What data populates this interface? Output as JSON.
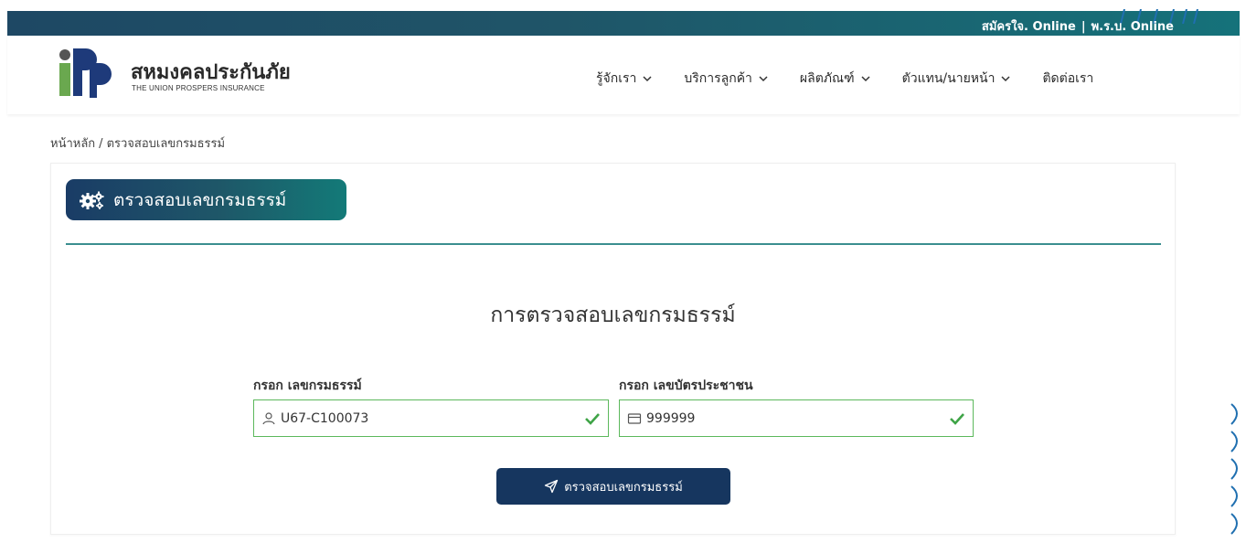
{
  "topbar": {
    "link_1": "สมัครใจ. Online",
    "separator": "|",
    "link_2": "พ.ร.บ. Online"
  },
  "brand": {
    "name_th": "สหมงคลประกันภัย",
    "name_en": "THE UNION PROSPERS INSURANCE",
    "colors": {
      "navy": "#16365f",
      "teal": "#137a78",
      "green": "#6aa84f"
    }
  },
  "nav": {
    "items": [
      {
        "label": "รู้จักเรา",
        "has_dropdown": true
      },
      {
        "label": "บริการลูกค้า",
        "has_dropdown": true
      },
      {
        "label": "ผลิตภัณฑ์",
        "has_dropdown": true
      },
      {
        "label": "ตัวแทน/นายหน้า",
        "has_dropdown": true
      },
      {
        "label": "ติดต่อเรา",
        "has_dropdown": false
      }
    ]
  },
  "breadcrumb": {
    "home": "หน้าหลัก",
    "separator": "/",
    "current": "ตรวจสอบเลขกรมธรรม์"
  },
  "card": {
    "heading": "ตรวจสอบเลขกรมธรรม์",
    "heading_icon": "gears-icon"
  },
  "form": {
    "title": "การตรวจสอบเลขกรมธรรม์",
    "policy": {
      "label": "กรอก เลขกรมธรรม์",
      "value": "U67-C100073",
      "icon": "user-icon",
      "valid": true
    },
    "id_card": {
      "label": "กรอก เลขบัตรประชาชน",
      "value": "999999",
      "icon": "id-card-icon",
      "valid": true
    },
    "submit_label": "ตรวจสอบเลขกรมธรรม์",
    "submit_icon": "send-icon"
  }
}
